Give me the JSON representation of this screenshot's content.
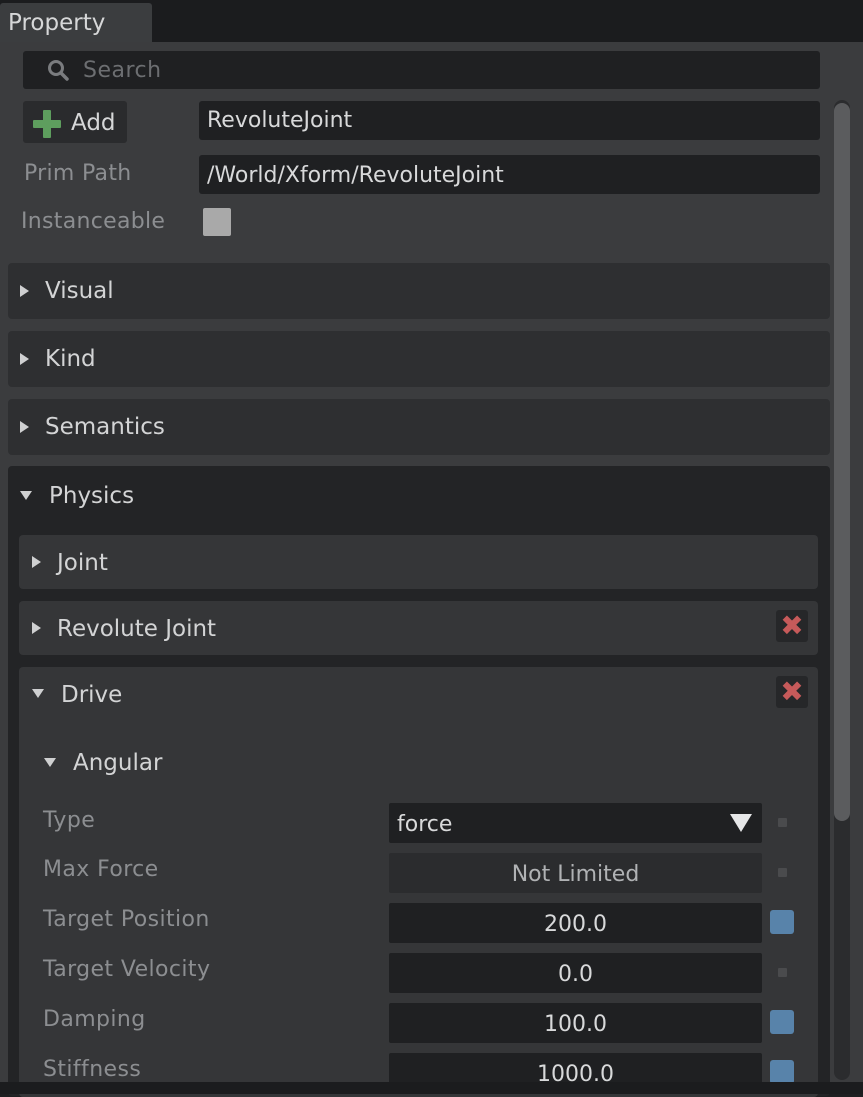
{
  "tab": {
    "label": "Property"
  },
  "search": {
    "placeholder": "Search"
  },
  "header": {
    "add_label": "Add",
    "name_value": "RevoluteJoint",
    "prim_path_label": "Prim Path",
    "prim_path_value": "/World/Xform/RevoluteJoint",
    "instanceable_label": "Instanceable",
    "instanceable_checked": false
  },
  "sections": {
    "visual": "Visual",
    "kind": "Kind",
    "semantics": "Semantics",
    "physics": "Physics",
    "joint": "Joint",
    "revolute_joint": "Revolute Joint",
    "drive": "Drive",
    "angular": "Angular"
  },
  "properties": [
    {
      "label": "Type",
      "value": "force",
      "kind": "dropdown",
      "indicator": "default"
    },
    {
      "label": "Max Force",
      "value": "Not Limited",
      "kind": "readonly",
      "indicator": "default"
    },
    {
      "label": "Target Position",
      "value": "200.0",
      "kind": "number",
      "indicator": "authored"
    },
    {
      "label": "Target Velocity",
      "value": "0.0",
      "kind": "number",
      "indicator": "default"
    },
    {
      "label": "Damping",
      "value": "100.0",
      "kind": "number",
      "indicator": "authored"
    },
    {
      "label": "Stiffness",
      "value": "1000.0",
      "kind": "number",
      "indicator": "authored"
    }
  ],
  "colors": {
    "authored_indicator": "#5883aa",
    "delete_icon": "#c65a5a",
    "add_icon": "#5e9e5e"
  }
}
